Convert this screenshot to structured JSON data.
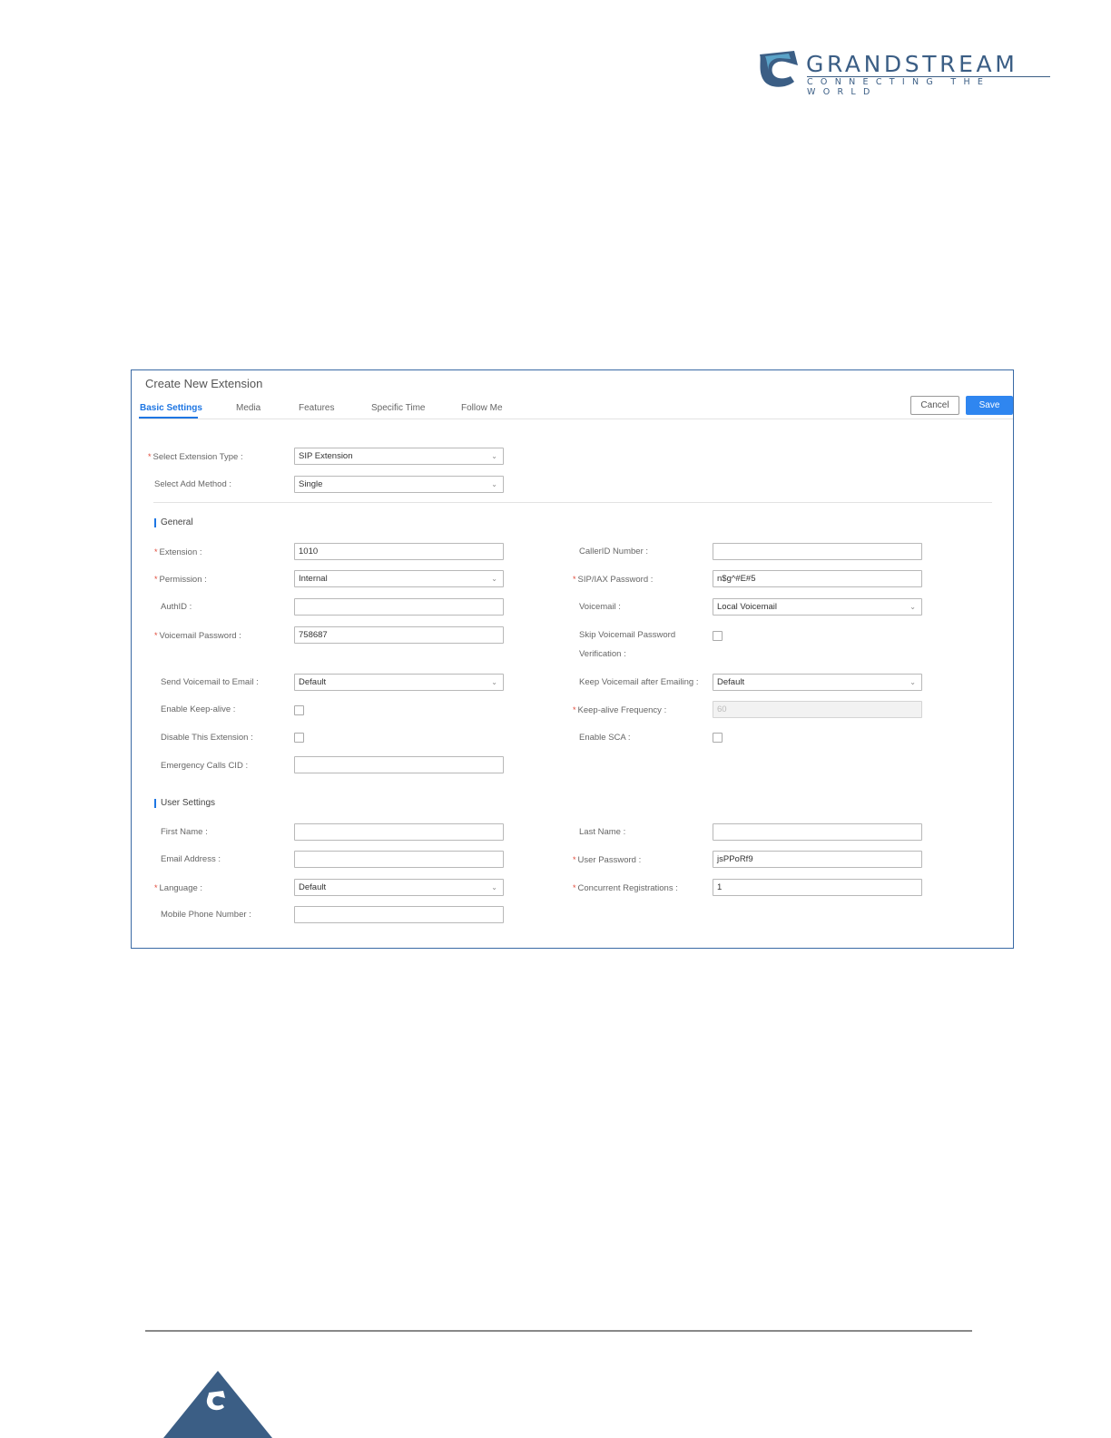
{
  "brand": {
    "name": "GRANDSTREAM",
    "tagline": "CONNECTING THE WORLD"
  },
  "dialog": {
    "title": "Create New Extension",
    "tabs": [
      "Basic Settings",
      "Media",
      "Features",
      "Specific Time",
      "Follow Me"
    ],
    "cancel_label": "Cancel",
    "save_label": "Save"
  },
  "top_fields": {
    "extension_type": {
      "label": "Select Extension Type :",
      "value": "SIP Extension"
    },
    "add_method": {
      "label": "Select Add Method :",
      "value": "Single"
    }
  },
  "general": {
    "title": "General",
    "extension": {
      "label": "Extension :",
      "value": "1010"
    },
    "callerid_number": {
      "label": "CallerID Number :",
      "value": ""
    },
    "permission": {
      "label": "Permission :",
      "value": "Internal"
    },
    "sip_password": {
      "label": "SIP/IAX Password :",
      "value": "n$g^#E#5"
    },
    "authid": {
      "label": "AuthID :",
      "value": ""
    },
    "voicemail": {
      "label": "Voicemail :",
      "value": "Local Voicemail"
    },
    "voicemail_password": {
      "label": "Voicemail Password :",
      "value": "758687"
    },
    "skip_voicemail_pw": {
      "label": "Skip Voicemail Password Verification :"
    },
    "send_voicemail_email": {
      "label": "Send Voicemail to Email :",
      "value": "Default"
    },
    "keep_voicemail": {
      "label": "Keep Voicemail after Emailing :",
      "value": "Default"
    },
    "enable_keepalive": {
      "label": "Enable Keep-alive :"
    },
    "keepalive_frequency": {
      "label": "Keep-alive Frequency :",
      "value": "60"
    },
    "disable_extension": {
      "label": "Disable This Extension :"
    },
    "enable_sca": {
      "label": "Enable SCA :"
    },
    "emergency_cid": {
      "label": "Emergency Calls CID :",
      "value": ""
    }
  },
  "user_settings": {
    "title": "User Settings",
    "first_name": {
      "label": "First Name :",
      "value": ""
    },
    "last_name": {
      "label": "Last Name :",
      "value": ""
    },
    "email": {
      "label": "Email Address :",
      "value": ""
    },
    "user_password": {
      "label": "User Password :",
      "value": "jsPPoRf9"
    },
    "language": {
      "label": "Language :",
      "value": "Default"
    },
    "concurrent_registrations": {
      "label": "Concurrent Registrations :",
      "value": "1"
    },
    "mobile_phone": {
      "label": "Mobile Phone Number :",
      "value": ""
    }
  },
  "colors": {
    "accent": "#1e76e3",
    "save_button": "#2f86f0",
    "brand": "#3b5e85",
    "required_marker": "#e04a3a",
    "frame_border": "#3a6aa5"
  },
  "icons": [
    "grandstream-logo-icon",
    "chevron-down-icon",
    "checkbox-icon",
    "footer-logo-icon"
  ]
}
